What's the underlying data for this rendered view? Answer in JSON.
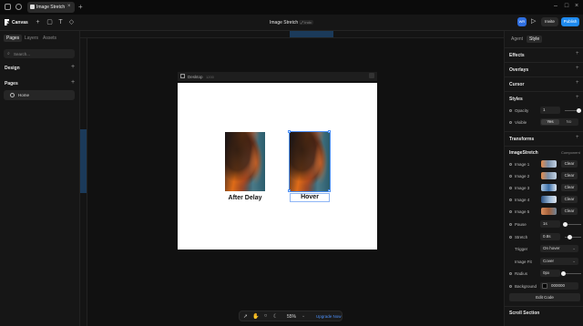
{
  "tabbar": {
    "active_tab": "Image Stretch",
    "new_tab": "+",
    "close": "×"
  },
  "toolbar": {
    "menu_label": "Canvas",
    "doc_title": "Image Stretch",
    "doc_badge": "⤢ Indx",
    "avatar": "WR",
    "invite": "Invite",
    "publish": "Publish"
  },
  "left_panel": {
    "tabs": [
      "Pages",
      "Layers",
      "Assets"
    ],
    "search_placeholder": "Search...",
    "design_label": "Design",
    "pages_label": "Pages",
    "home_label": "Home"
  },
  "canvas": {
    "frame_name": "Desktop",
    "frame_width": "1200",
    "caption_left": "After Delay",
    "caption_right": "Hover"
  },
  "bottom_bar": {
    "zoom": "55%",
    "upgrade": "Upgrade Now"
  },
  "right_panel": {
    "tabs": [
      "Agent",
      "Style"
    ],
    "effects": "Effects",
    "overlays": "Overlays",
    "cursor": "Cursor",
    "styles": "Styles",
    "opacity_label": "Opacity",
    "opacity_value": "1",
    "visible_label": "Visible",
    "visible_yes": "Yes",
    "visible_no": "No",
    "transforms": "Transforms",
    "component_name": "ImageStretch",
    "component_link": "Component",
    "images": [
      {
        "label": "Image 1",
        "clear": "Clear"
      },
      {
        "label": "Image 2",
        "clear": "Clear"
      },
      {
        "label": "Image 3",
        "clear": "Clear"
      },
      {
        "label": "Image 4",
        "clear": "Clear"
      },
      {
        "label": "Image 5",
        "clear": "Clear"
      }
    ],
    "pause_label": "Pause",
    "pause_value": "1s",
    "stretch_label": "Stretch",
    "stretch_value": "0.8s",
    "trigger_label": "Trigger",
    "trigger_value": "On hover",
    "imagefit_label": "Image Fit",
    "imagefit_value": "Cover",
    "radius_label": "Radius",
    "radius_value": "0px",
    "background_label": "Background",
    "background_value": "000000",
    "edit_code": "Edit Code",
    "scroll_section": "Scroll Section"
  }
}
